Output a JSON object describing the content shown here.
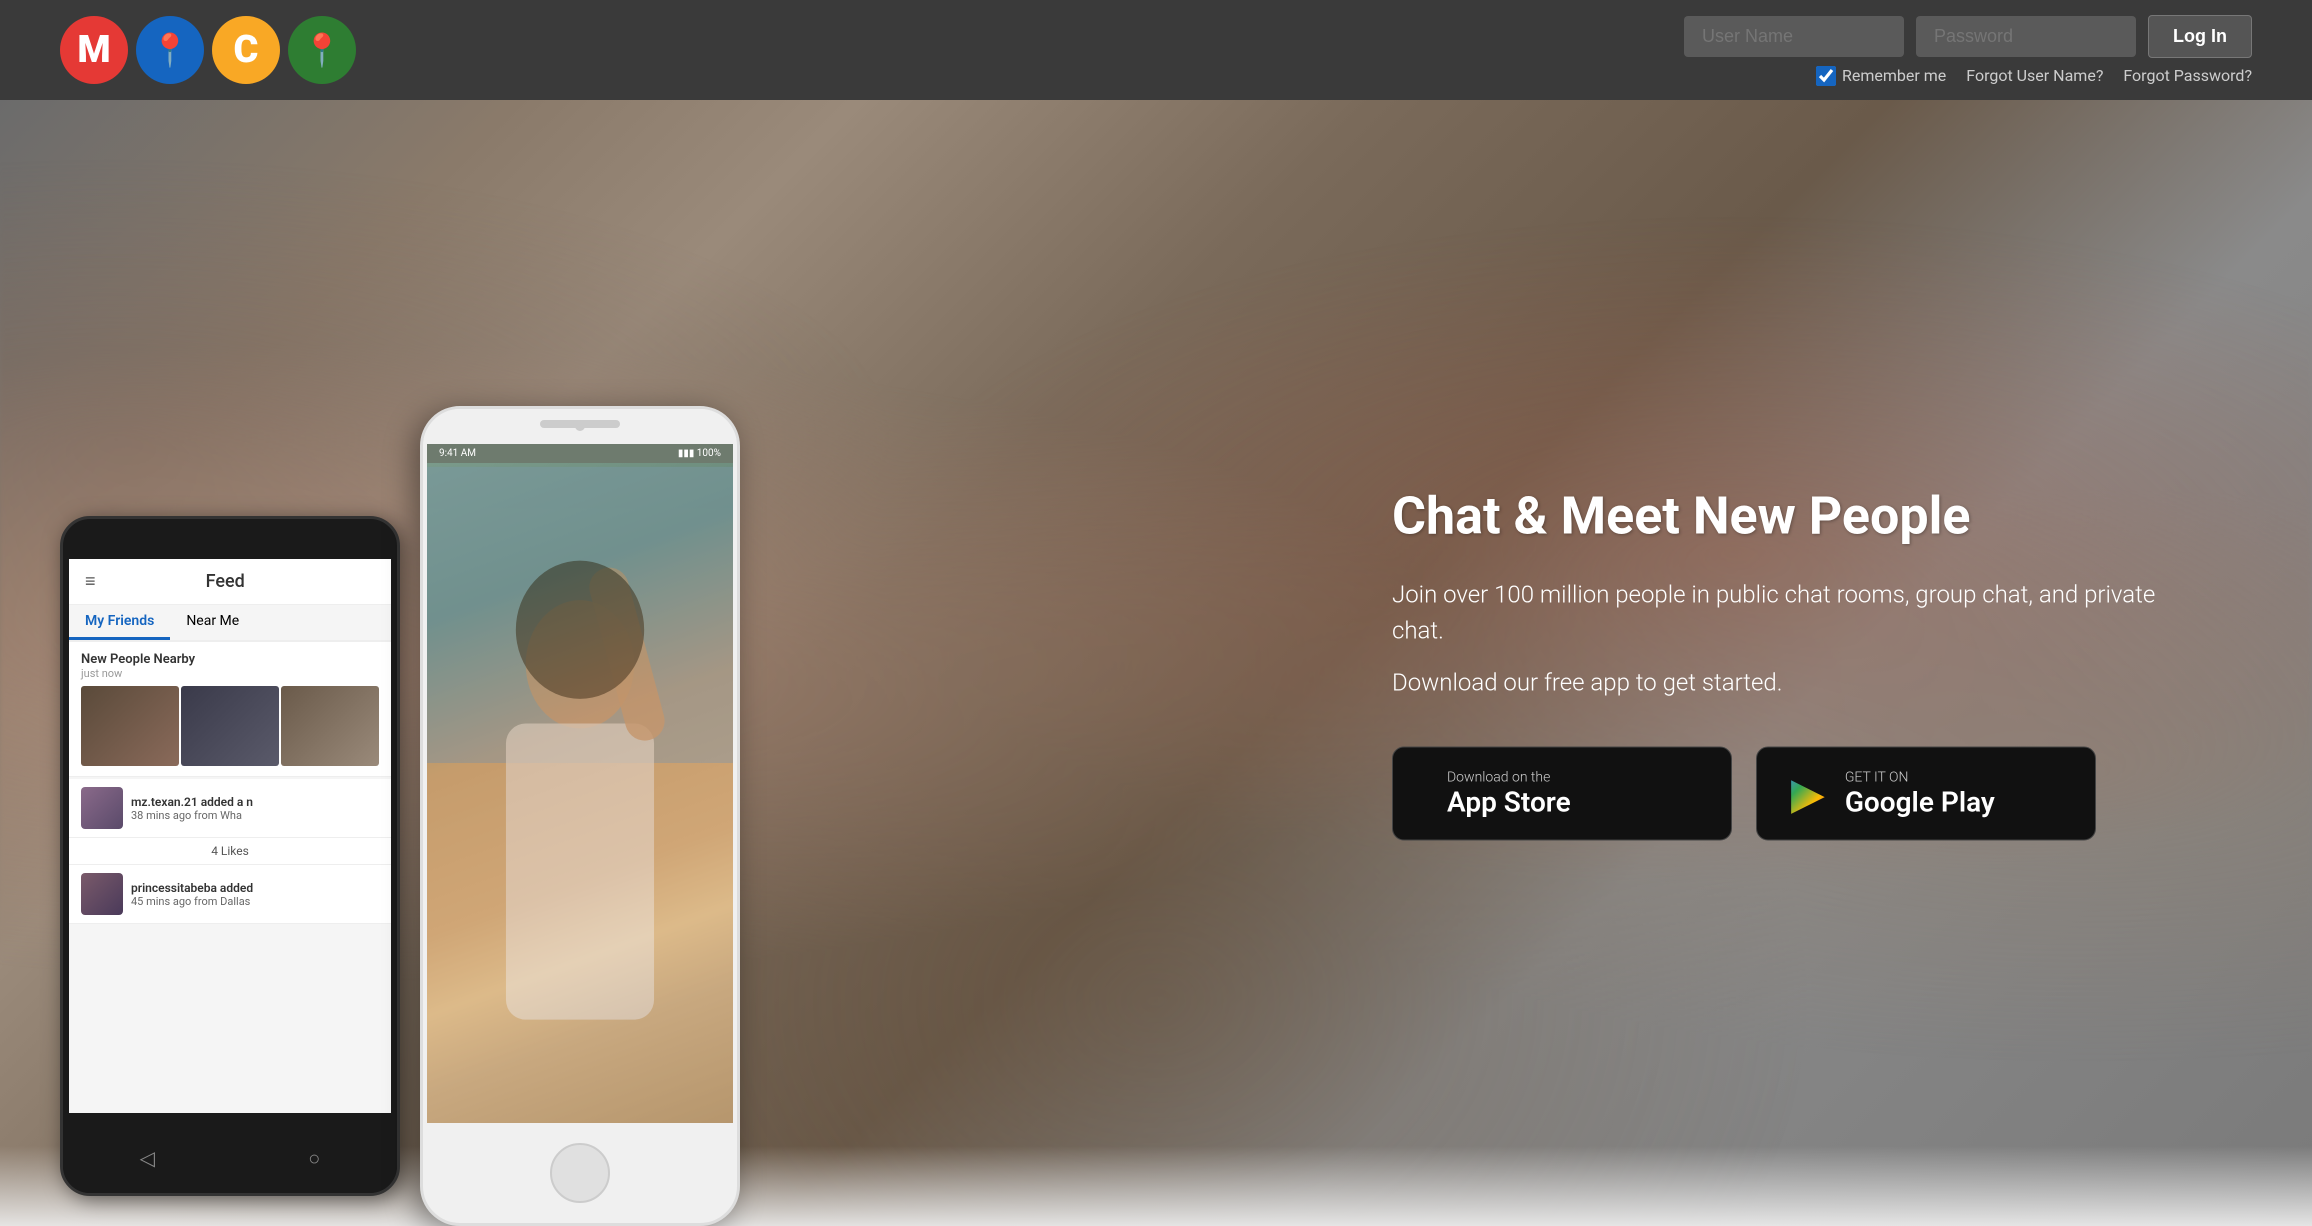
{
  "header": {
    "logo": {
      "letters": [
        {
          "char": "M",
          "class": "logo-m"
        },
        {
          "char": "◉",
          "class": "logo-o1"
        },
        {
          "char": "C",
          "class": "logo-c"
        },
        {
          "char": "◉",
          "class": "logo-o2"
        }
      ]
    },
    "username_placeholder": "User Name",
    "password_placeholder": "Password",
    "login_label": "Log In",
    "remember_label": "Remember me",
    "forgot_username_label": "Forgot User Name?",
    "forgot_password_label": "Forgot Password?"
  },
  "hero": {
    "title": "Chat & Meet New People",
    "description": "Join over 100 million people in public chat rooms, group chat, and private chat.",
    "cta": "Download our free app to get started.",
    "app_store": {
      "small_text": "Download on the",
      "large_text": "App Store",
      "icon": ""
    },
    "google_play": {
      "small_text": "GET IT ON",
      "large_text": "Google Play",
      "icon": "▶"
    }
  },
  "feed": {
    "title": "Feed",
    "tabs": [
      "My Friends",
      "Near Me"
    ],
    "nearby_title": "New People Nearby",
    "nearby_sub": "just now",
    "user1_name": "mz.texan.21 added a n",
    "user1_time": "38 mins ago from Wha",
    "likes_text": "4 Likes",
    "user2_name": "princessitabeba added",
    "user2_time": "45 mins ago from Dallas"
  }
}
